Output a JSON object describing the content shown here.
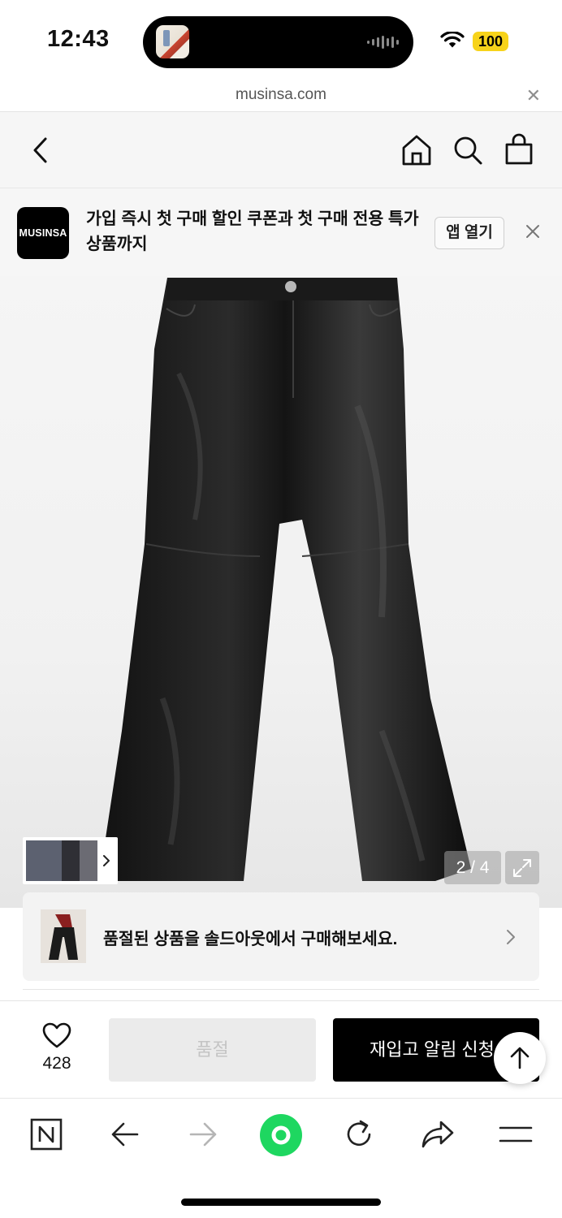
{
  "status_bar": {
    "time": "12:43",
    "battery": "100",
    "icons": [
      "wifi-icon",
      "battery-icon",
      "now-playing-icon"
    ]
  },
  "url_bar": {
    "url": "musinsa.com",
    "close_icon": "close-icon"
  },
  "nav": {
    "icons": [
      "back-icon",
      "home-icon",
      "search-icon",
      "shopping-bag-icon"
    ]
  },
  "app_banner": {
    "logo": "MUSINSA",
    "text": "가입 즉시 첫 구매 할인 쿠폰과 첫 구매 전용 특가 상품까지",
    "open_app": "앱 열기",
    "close_icon": "close-icon"
  },
  "gallery": {
    "pager": "2 / 4",
    "current": 2,
    "total": 4,
    "icons": [
      "chevron-right-icon",
      "expand-icon"
    ]
  },
  "soldout_notice": {
    "text": "품절된 상품을 솔드아웃에서 구매해보세요.",
    "icon": "chevron-right-icon"
  },
  "actions": {
    "like_count": "428",
    "soldout_label": "품절",
    "restock_label": "재입고 알림 신청",
    "icons": [
      "heart-icon",
      "arrow-up-icon"
    ]
  },
  "colors": {
    "primary_button": "#000000",
    "disabled_button": "#ebebeb",
    "banner_bg": "#f6f6f6",
    "accent_green": "#1ed760",
    "battery": "#f7d31a"
  },
  "browser_toolbar": {
    "icons": [
      "naver-n-icon",
      "back-arrow-icon",
      "forward-arrow-icon",
      "green-dot-icon",
      "reload-icon",
      "share-icon",
      "menu-icon"
    ]
  }
}
